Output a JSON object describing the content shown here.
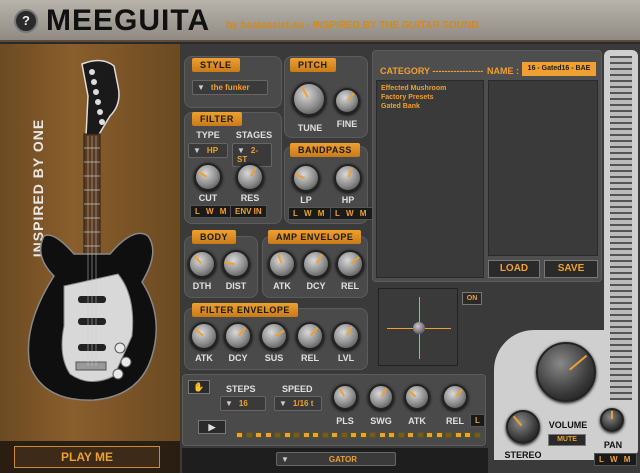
{
  "app": {
    "help_label": "?",
    "title": "MEEGUITA",
    "tagline": "by beatassist.eu - INSPIRED BY THE GUITAR SOUND",
    "vertical_text": "INSPIRED BY ONE",
    "play_button": "PLAY ME"
  },
  "style": {
    "label": "STYLE",
    "value": "the funker"
  },
  "pitch": {
    "label": "PITCH",
    "tune": "TUNE",
    "fine": "FINE"
  },
  "filter": {
    "label": "FILTER",
    "type_label": "TYPE",
    "type_value": "HP",
    "stages_label": "STAGES",
    "stages_value": "2-ST",
    "cut": "CUT",
    "res": "RES",
    "lwm": "L W M",
    "env_in": "ENV IN"
  },
  "bandpass": {
    "label": "BANDPASS",
    "lp": "LP",
    "hp": "HP",
    "lwm1": "L W M",
    "lwm2": "L W M"
  },
  "body": {
    "label": "BODY",
    "dth": "DTH",
    "dist": "DIST"
  },
  "amp_envelope": {
    "label": "AMP ENVELOPE",
    "atk": "ATK",
    "dcy": "DCY",
    "rel": "REL"
  },
  "filter_envelope": {
    "label": "FILTER ENVELOPE",
    "atk": "ATK",
    "dcy": "DCY",
    "sus": "SUS",
    "rel": "REL",
    "lvl": "LVL"
  },
  "browser": {
    "category_label": "CATEGORY -----------------",
    "name_label": "NAME :",
    "name_value": "16 - Gated16 - BAE",
    "categories": [
      "Effected Mushroom",
      "Factory Presets",
      "Gated Bank"
    ],
    "load": "LOAD",
    "save": "SAVE"
  },
  "xy": {
    "on_label": "ON"
  },
  "sequencer": {
    "steps_label": "STEPS",
    "steps_value": "16",
    "speed_label": "SPEED",
    "speed_value": "1/16 t",
    "pls": "PLS",
    "swg": "SWG",
    "atk": "ATK",
    "rel": "REL",
    "l": "L",
    "play_icon": "▶",
    "pattern_value": "GATOR",
    "leds_on": [
      1,
      0,
      1,
      1,
      0,
      1,
      0,
      1,
      1,
      0,
      1,
      0,
      1,
      1,
      0,
      1,
      1,
      0,
      1,
      0,
      1,
      1,
      0,
      1,
      1,
      0
    ]
  },
  "output": {
    "volume": "VOLUME",
    "mute": "MUTE",
    "stereo": "STEREO",
    "pan": "PAN",
    "lwm": "L W M"
  }
}
